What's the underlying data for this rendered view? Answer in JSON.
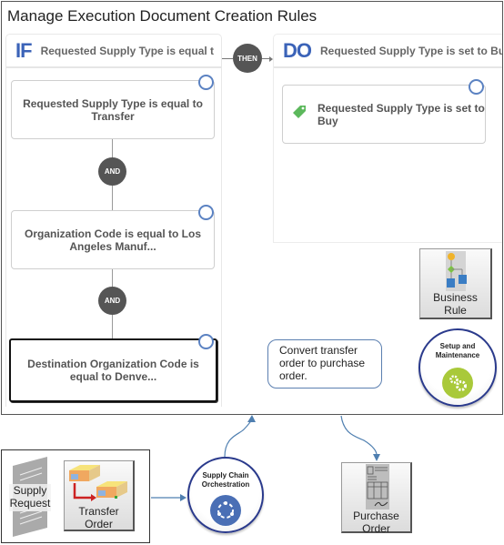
{
  "title": "Manage Execution Document Creation Rules",
  "if_panel": {
    "keyword": "IF",
    "header": "Requested Supply Type is equal t",
    "conditions": [
      {
        "text": "Requested Supply Type is equal to Transfer",
        "selected": false
      },
      {
        "text": "Organization Code is equal to Los Angeles Manuf...",
        "selected": false
      },
      {
        "text": "Destination Organization Code is equal to Denve...",
        "selected": true
      }
    ],
    "connector": "AND"
  },
  "then_label": "THEN",
  "do_panel": {
    "keyword": "DO",
    "header": "Requested Supply Type is set to Bu",
    "action": {
      "text": "Requested Supply Type is set to Buy",
      "icon": "tag-icon"
    }
  },
  "business_rule": {
    "label_line1": "Business",
    "label_line2": "Rule",
    "icon": "flowchart-icon"
  },
  "setup_maintenance": {
    "label_line1": "Setup and",
    "label_line2": "Maintenance",
    "icon": "gears-icon"
  },
  "callout": {
    "text": "Convert  transfer order  to purchase order."
  },
  "supply_request": {
    "label_line1": "Supply",
    "label_line2": "Request",
    "icon": "document-icon"
  },
  "transfer_order": {
    "label_line1": "Transfer",
    "label_line2": "Order",
    "icon": "warehouse-transfer-icon"
  },
  "supply_chain_orchestration": {
    "label_line1": "Supply Chain",
    "label_line2": "Orchestration",
    "icon": "cycle-icon"
  },
  "purchase_order": {
    "label_line1": "Purchase",
    "label_line2": "Order",
    "icon": "purchase-document-icon"
  },
  "colors": {
    "keyword_blue": "#3b63b8",
    "ring_blue": "#5b82c2",
    "connector_gray": "#555555",
    "tag_green": "#5cb85c",
    "badge_border": "#2a3a8c",
    "gear_green": "#a9c93a",
    "orchestration_blue": "#4a6fb5",
    "arrow_blue": "#4f7fb0"
  }
}
